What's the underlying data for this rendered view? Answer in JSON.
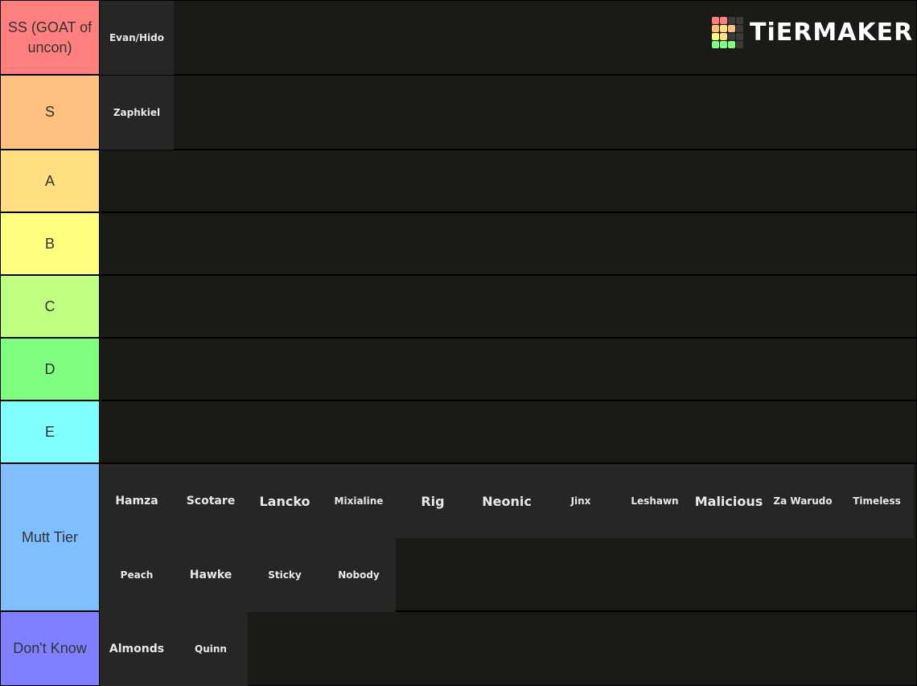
{
  "logo": {
    "text": "TiERMAKER",
    "grid_colors": [
      "#ff7f7f",
      "#ff7f7f",
      "#3a3a3a",
      "#3a3a3a",
      "#ffbf7f",
      "#ffdf7f",
      "#ffbf7f",
      "#3a3a3a",
      "#ffff7f",
      "#ffdf7f",
      "#3a3a3a",
      "#3a3a3a",
      "#7fff7f",
      "#7fff7f",
      "#7fff7f",
      "#3a3a3a"
    ]
  },
  "tiers": [
    {
      "label": "SS (GOAT of uncon)",
      "color": "#ff7f7f",
      "height": 93,
      "items": [
        "Evan/Hido"
      ]
    },
    {
      "label": "S",
      "color": "#ffbf7f",
      "height": 93,
      "items": [
        "Zaphkiel"
      ]
    },
    {
      "label": "A",
      "color": "#ffdf7f",
      "height": 78,
      "items": []
    },
    {
      "label": "B",
      "color": "#ffff7f",
      "height": 78,
      "items": []
    },
    {
      "label": "C",
      "color": "#bfff7f",
      "height": 78,
      "items": []
    },
    {
      "label": "D",
      "color": "#7fff7f",
      "height": 78,
      "items": []
    },
    {
      "label": "E",
      "color": "#7fffff",
      "height": 78,
      "items": []
    },
    {
      "label": "Mutt Tier",
      "color": "#7fbfff",
      "height": 184,
      "items": [
        "Hamza",
        "Scotare",
        "Lancko",
        "Mixialine",
        "Rig",
        "Neonic",
        "Jinx",
        "Leshawn",
        "Malicious",
        "Za Warudo",
        "Timeless",
        "Peach",
        "Hawke",
        "Sticky",
        "Nobody"
      ]
    },
    {
      "label": "Don't Know",
      "color": "#7f7fff",
      "height": 91,
      "items": [
        "Almonds",
        "Quinn"
      ]
    }
  ]
}
